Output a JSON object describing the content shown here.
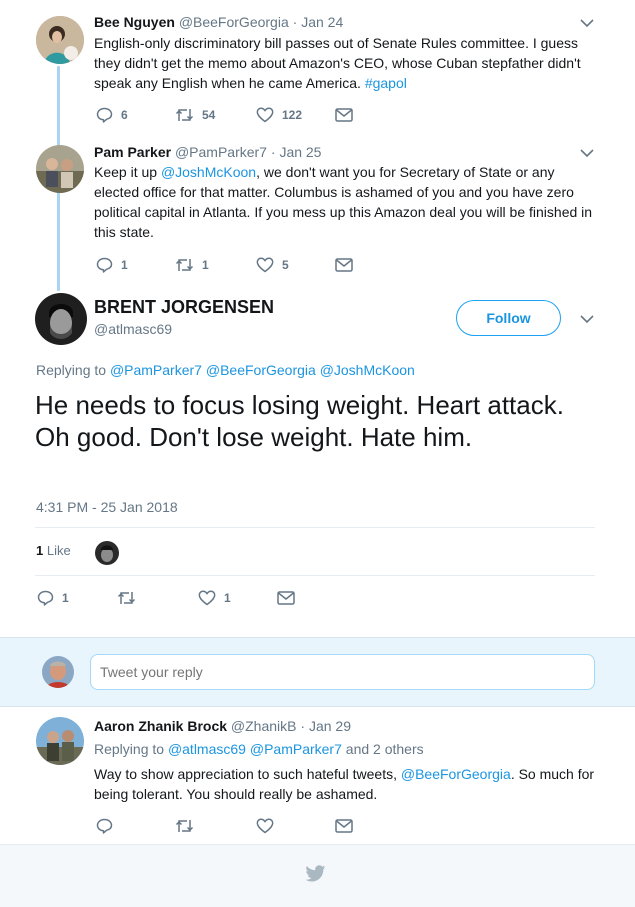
{
  "tweets": [
    {
      "name": "Bee Nguyen",
      "handle": "@BeeForGeorgia",
      "sep": "·",
      "date": "Jan 24",
      "text_plain": "English-only discriminatory bill passes out of Senate Rules committee. I guess they didn't get the memo about Amazon's CEO, whose Cuban stepfather didn't speak any English when he came America. ",
      "hashtag": "#gapol",
      "replies": "6",
      "retweets": "54",
      "likes": "122"
    },
    {
      "name": "Pam Parker",
      "handle": "@PamParker7",
      "sep": "·",
      "date": "Jan 25",
      "text_pre": "Keep it up ",
      "mention": "@JoshMcKoon",
      "text_post": ", we don't want you for Secretary of State or any elected office for that matter.  Columbus is ashamed of you and you have zero political capital in Atlanta.  If you mess up this Amazon deal you will be finished in this state.",
      "replies": "1",
      "retweets": "1",
      "likes": "5"
    }
  ],
  "main": {
    "name": "BRENT JORGENSEN",
    "handle": "@atlmasc69",
    "follow_label": "Follow",
    "replying_prefix": "Replying to",
    "replying_to": [
      "@PamParker7",
      "@BeeForGeorgia",
      "@JoshMcKoon"
    ],
    "text": "He needs to focus losing weight. Heart attack. Oh good. Don't lose weight. Hate him.",
    "timestamp": "4:31 PM - 25 Jan 2018",
    "likes_count": "1",
    "likes_word": "Like",
    "replies": "1",
    "likes": "1"
  },
  "reply_box": {
    "placeholder": "Tweet your reply"
  },
  "reply": {
    "name": "Aaron Zhanik Brock",
    "handle": "@ZhanikB",
    "sep": "·",
    "date": "Jan 29",
    "replying_prefix": "Replying to",
    "replying_to": [
      "@atlmasc69",
      "@PamParker7"
    ],
    "replying_others": "and 2 others",
    "text_pre": "Way to show appreciation to such hateful tweets, ",
    "mention": "@BeeForGeorgia",
    "text_post": ". So much for being tolerant. You should really be ashamed."
  },
  "colors": {
    "link": "#1b95e0",
    "muted": "#657786",
    "thread_line": "#a9d5f2",
    "footer_bg": "#f5f8fa"
  }
}
